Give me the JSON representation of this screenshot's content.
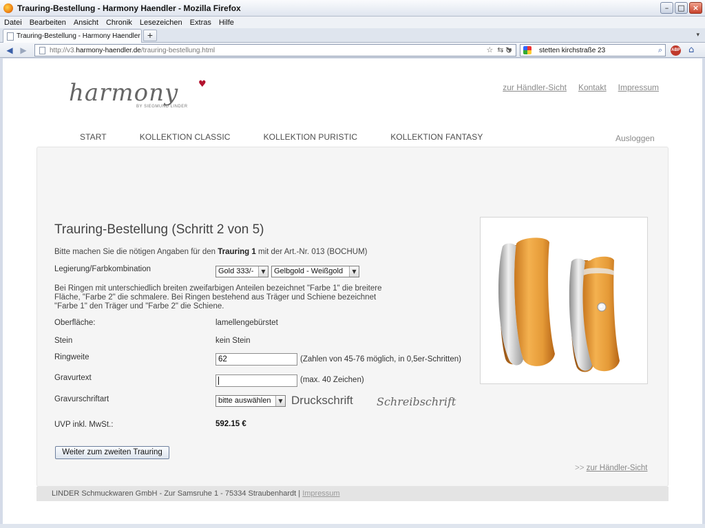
{
  "window": {
    "title": "Trauring-Bestellung - Harmony Haendler - Mozilla Firefox",
    "min_label": "–",
    "max_label": "□",
    "close_label": "×"
  },
  "menubar": {
    "items": [
      "Datei",
      "Bearbeiten",
      "Ansicht",
      "Chronik",
      "Lesezeichen",
      "Extras",
      "Hilfe"
    ]
  },
  "tabs": {
    "active_label": "Trauring-Bestellung - Harmony Haendler",
    "new_tab_label": "+",
    "list_label": "▾"
  },
  "navigation": {
    "back_icon": "back-arrow-icon",
    "forward_icon": "forward-arrow-icon",
    "url_prefix": "http://v3.",
    "url_domain": "harmony-haendler.de",
    "url_path": "/trauring-bestellung.html",
    "search_value": "stetten kirchstraße 23",
    "abp_label": "ABP"
  },
  "site": {
    "logo_text": "harmony",
    "logo_subtext": "BY SIEGMUND LINDER",
    "top_links": [
      "zur Händler-Sicht",
      "Kontakt",
      "Impressum"
    ],
    "nav": [
      "START",
      "KOLLEKTION CLASSIC",
      "KOLLEKTION PURISTIC",
      "KOLLEKTION FANTASY"
    ],
    "logout": "Ausloggen"
  },
  "form": {
    "title": "Trauring-Bestellung (Schritt 2 von 5)",
    "intro_a": "Bitte machen Sie die nötigen Angaben für den ",
    "intro_b": "Trauring 1",
    "intro_c": " mit der Art.-Nr. 013 (BOCHUM)",
    "alloy_label": "Legierung/Farbkombination",
    "alloy_value": "Gold 333/-",
    "color_value": "Gelbgold - Weißgold",
    "description": "Bei Ringen mit unterschiedlich breiten zweifarbigen Anteilen bezeichnet \"Farbe 1\" die breitere Fläche, \"Farbe 2\" die schmalere. Bei Ringen bestehend aus Träger und Schiene bezeichnet \"Farbe 1\" den Träger und \"Farbe 2\" die Schiene.",
    "surface_label": "Oberfläche:",
    "surface_value": "lamellengebürstet",
    "stone_label": "Stein",
    "stone_value": "kein Stein",
    "size_label": "Ringweite",
    "size_value": "62",
    "size_hint": "(Zahlen von 45-76 möglich, in 0,5er-Schritten)",
    "engraving_label": "Gravurtext",
    "engraving_value": "",
    "engraving_hint": "(max. 40 Zeichen)",
    "font_label": "Gravurschriftart",
    "font_value": "bitte auswählen",
    "font_sample_print": "Druckschrift",
    "font_sample_script": "Schreibschrift",
    "price_label": "UVP inkl. MwSt.:",
    "price_value": "592.15 €",
    "next_button": "Weiter zum zweiten Trauring",
    "haendler_prefix": ">> ",
    "haendler_link": "zur Händler-Sicht"
  },
  "footer": {
    "text": "LINDER Schmuckwaren GmbH - Zur Samsruhe 1 - 75334 Straubenhardt | ",
    "link": "Impressum"
  }
}
